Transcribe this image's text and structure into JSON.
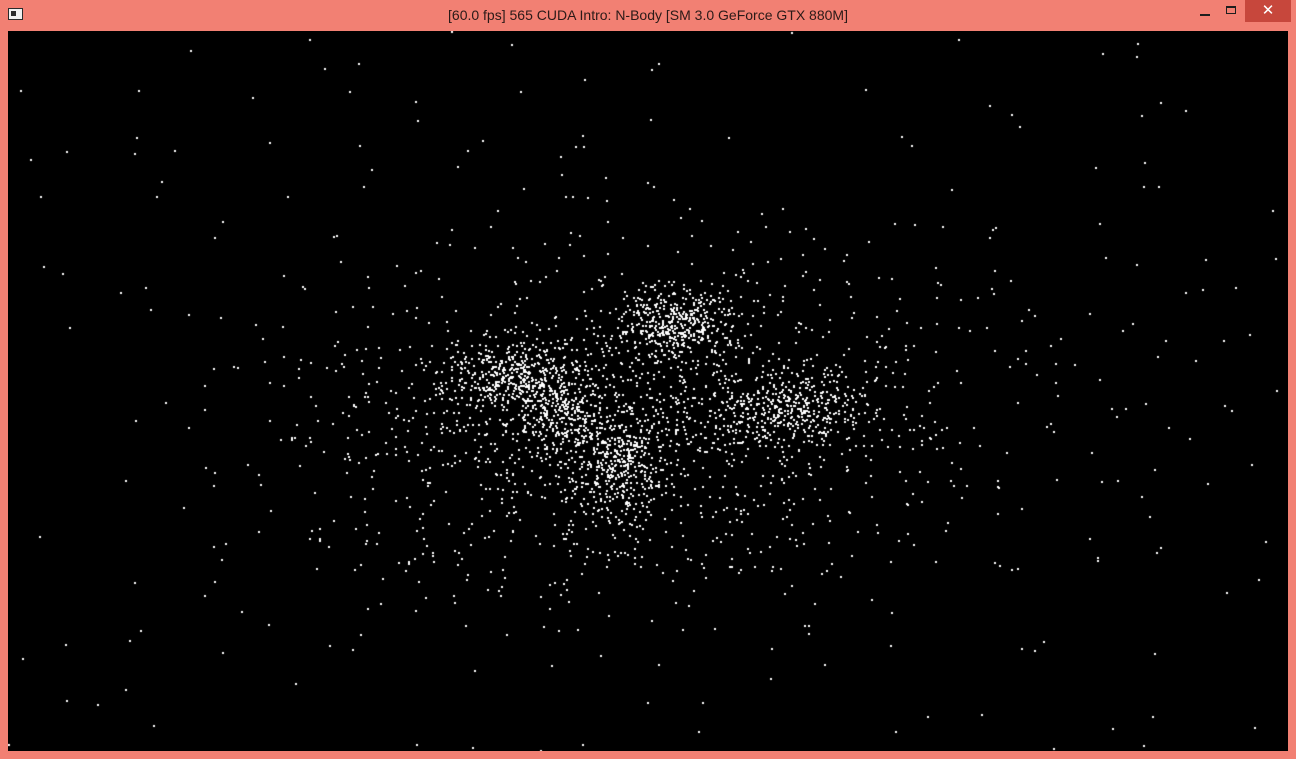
{
  "window": {
    "title": "[60.0 fps] 565 CUDA Intro: N-Body [SM 3.0 GeForce GTX 880M]",
    "controls": {
      "minimize_icon": "minimize-icon",
      "maximize_icon": "maximize-icon",
      "close_icon": "close-icon",
      "close_glyph": "✕"
    }
  },
  "colors": {
    "frame": "#f28073",
    "close_button": "#c7473c",
    "background": "#000000",
    "particles": "#ffffff"
  },
  "simulation": {
    "fps": "60.0",
    "app": "565 CUDA Intro: N-Body",
    "gpu": "SM 3.0 GeForce GTX 880M",
    "particles": "point cloud of bodies with four dense clusters"
  }
}
